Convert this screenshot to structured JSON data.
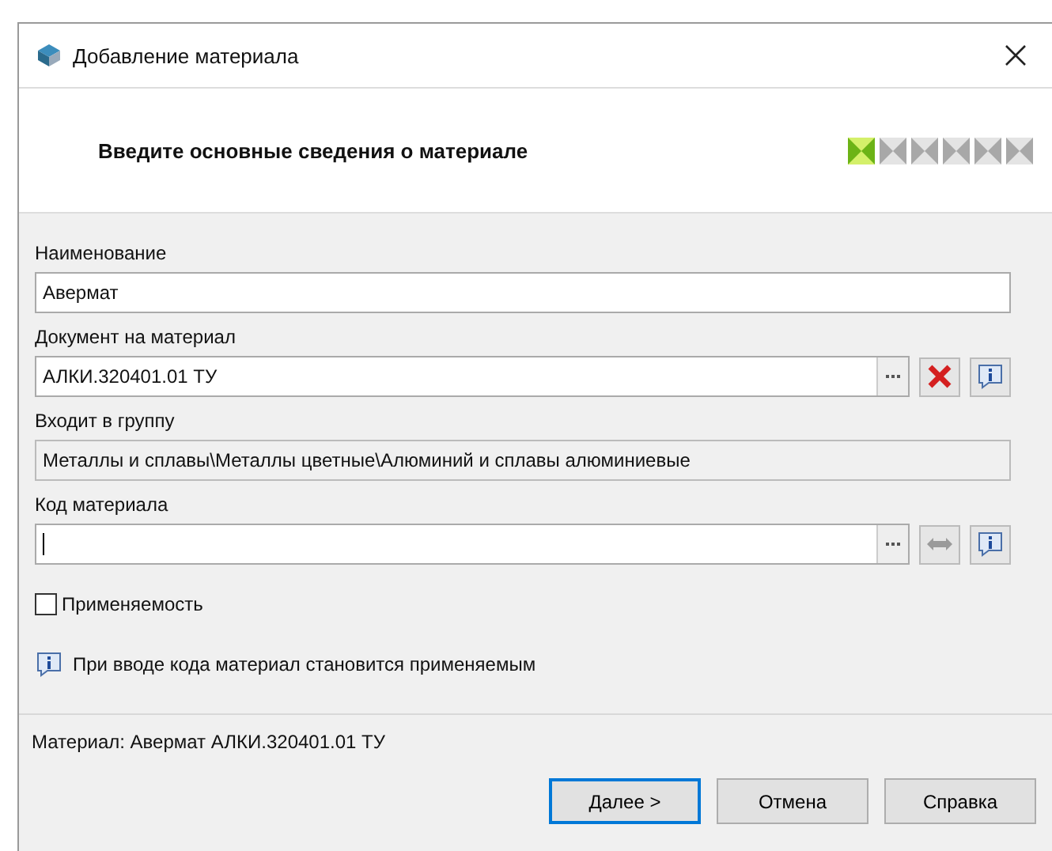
{
  "window": {
    "title": "Добавление материала"
  },
  "header": {
    "heading": "Введите основные сведения о материале",
    "steps": [
      {
        "selected": true
      },
      {
        "selected": false
      },
      {
        "selected": false
      },
      {
        "selected": false
      },
      {
        "selected": false
      },
      {
        "selected": false
      }
    ]
  },
  "fields": [
    {
      "kind": "text",
      "label": "Наименование",
      "value": "Авермат"
    },
    {
      "kind": "document",
      "label": "Документ на материал",
      "value": "АЛКИ.320401.01 ТУ"
    },
    {
      "kind": "readonly",
      "label": "Входит в группу",
      "value": "Металлы и сплавы\\Металлы цветные\\Алюминий и сплавы алюминиевые"
    },
    {
      "kind": "code",
      "label": "Код материала",
      "focused": true
    }
  ],
  "checkbox": {
    "label": "Применяемость",
    "checked": false
  },
  "hint": {
    "text": "При вводе кода материал становится применяемым"
  },
  "status": "Материал: Авермат АЛКИ.320401.01 ТУ",
  "buttons": [
    {
      "label": "Далее >",
      "default": true
    },
    {
      "label": "Отмена",
      "default": false
    },
    {
      "label": "Справка",
      "default": false
    }
  ]
}
